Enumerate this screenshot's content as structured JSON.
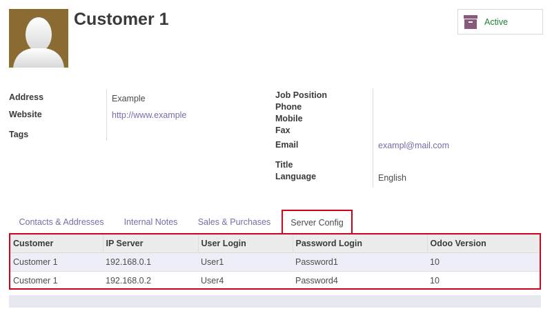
{
  "header": {
    "title": "Customer 1",
    "status_button": {
      "label": "Active",
      "icon": "archive-icon",
      "color": "#875a7b"
    }
  },
  "left_fields": [
    {
      "label": "Address",
      "value": "Example",
      "link": false
    },
    {
      "label": "Website",
      "value": "http://www.example",
      "link": true
    },
    {
      "label": "Tags",
      "value": "",
      "link": false
    }
  ],
  "right_fields": [
    {
      "label": "Job Position",
      "value": ""
    },
    {
      "label": "Phone",
      "value": ""
    },
    {
      "label": "Mobile",
      "value": ""
    },
    {
      "label": "Fax",
      "value": ""
    },
    {
      "label": "Email",
      "value": "exampl@mail.com"
    },
    {
      "label": "Title",
      "value": ""
    },
    {
      "label": "Language",
      "value": "English"
    }
  ],
  "tabs": [
    {
      "label": "Contacts & Addresses",
      "active": false
    },
    {
      "label": "Internal Notes",
      "active": false
    },
    {
      "label": "Sales & Purchases",
      "active": false
    },
    {
      "label": "Server Config",
      "active": true
    }
  ],
  "table": {
    "columns": [
      "Customer",
      "IP Server",
      "User Login",
      "Password Login",
      "Odoo Version"
    ],
    "rows": [
      [
        "Customer 1",
        "192.168.0.1",
        "User1",
        "Password1",
        "10"
      ],
      [
        "Customer 1",
        "192.168.0.2",
        "User4",
        "Password4",
        "10"
      ]
    ]
  },
  "colors": {
    "link": "#7c6aa8",
    "highlight_border": "#d0021b",
    "active_status": "#1e7e34"
  }
}
